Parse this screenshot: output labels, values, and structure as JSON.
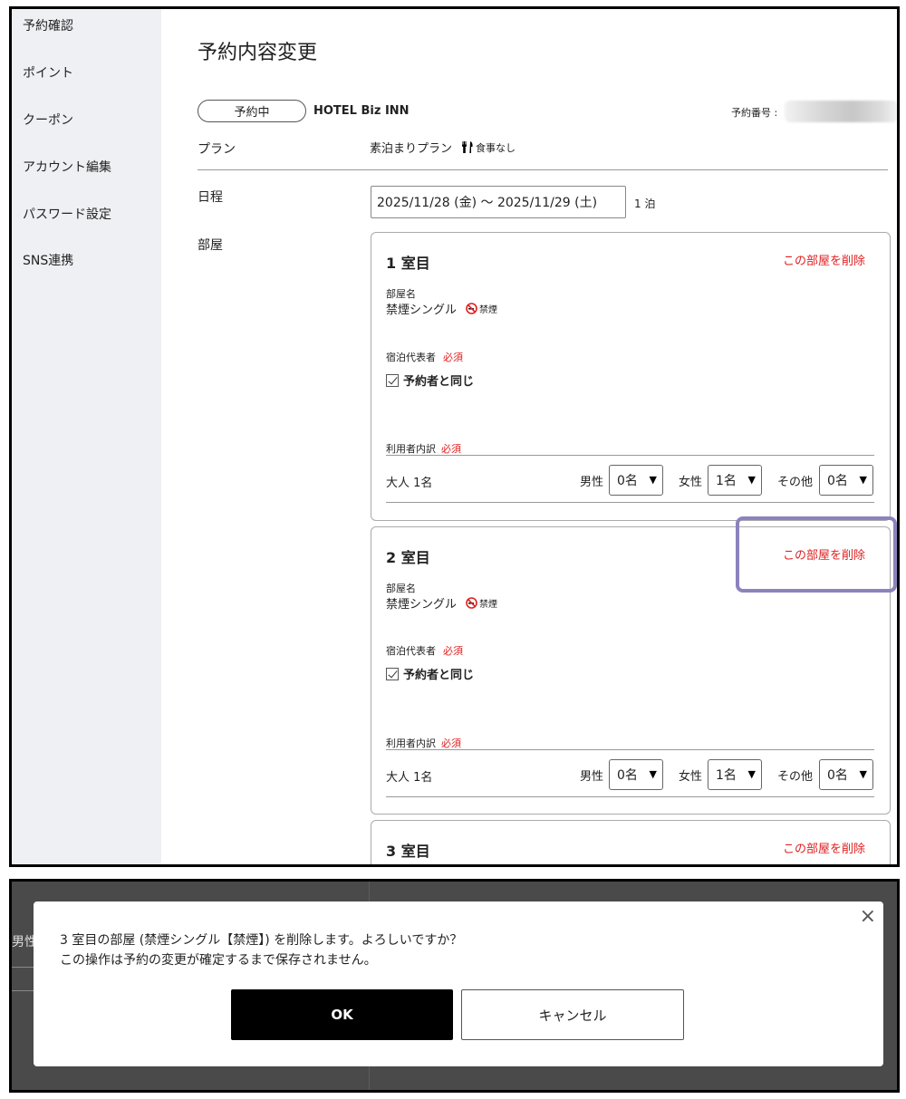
{
  "sidebar": {
    "items": [
      {
        "label": "予約確認"
      },
      {
        "label": "ポイント"
      },
      {
        "label": "クーポン"
      },
      {
        "label": "アカウント編集"
      },
      {
        "label": "パスワード設定"
      },
      {
        "label": "SNS連携"
      }
    ]
  },
  "page": {
    "title": "予約内容変更",
    "status": "予約中",
    "hotel": "HOTEL Biz INN",
    "reservation_number_label": "予約番号 :"
  },
  "plan": {
    "label": "プラン",
    "name": "素泊まりプラン",
    "meal": "食事なし"
  },
  "schedule": {
    "label": "日程",
    "dates": "2025/11/28 (金) 〜 2025/11/29 (土)",
    "nights": "1 泊"
  },
  "rooms_label": "部屋",
  "rooms": [
    {
      "title": "1 室目",
      "delete": "この部屋を削除",
      "room_name_label": "部屋名",
      "room_name": "禁煙シングル",
      "smoking": "禁煙",
      "representative_label": "宿泊代表者",
      "required": "必須",
      "same_as_booker": "予約者と同じ",
      "users_label": "利用者内訳",
      "adults": "大人 1名",
      "male_label": "男性",
      "male_value": "0名",
      "female_label": "女性",
      "female_value": "1名",
      "other_label": "その他",
      "other_value": "0名"
    },
    {
      "title": "2 室目",
      "delete": "この部屋を削除",
      "room_name_label": "部屋名",
      "room_name": "禁煙シングル",
      "smoking": "禁煙",
      "representative_label": "宿泊代表者",
      "required": "必須",
      "same_as_booker": "予約者と同じ",
      "users_label": "利用者内訳",
      "adults": "大人 1名",
      "male_label": "男性",
      "male_value": "0名",
      "female_label": "女性",
      "female_value": "1名",
      "other_label": "その他",
      "other_value": "0名"
    },
    {
      "title": "3 室目",
      "delete": "この部屋を削除"
    }
  ],
  "dialog": {
    "line1": "3 室目の部屋 (禁煙シングル【禁煙】) を削除します。よろしいですか？",
    "line2": "この操作は予約の変更が確定するまで保存されません。",
    "ok": "OK",
    "cancel": "キャンセル",
    "close": "×",
    "background_fragment": "男性"
  },
  "colors": {
    "accent_red": "#e02020",
    "highlight": "#8b83bd",
    "sidebar_bg": "#eef0f3",
    "overlay": "#4a4a4a"
  }
}
